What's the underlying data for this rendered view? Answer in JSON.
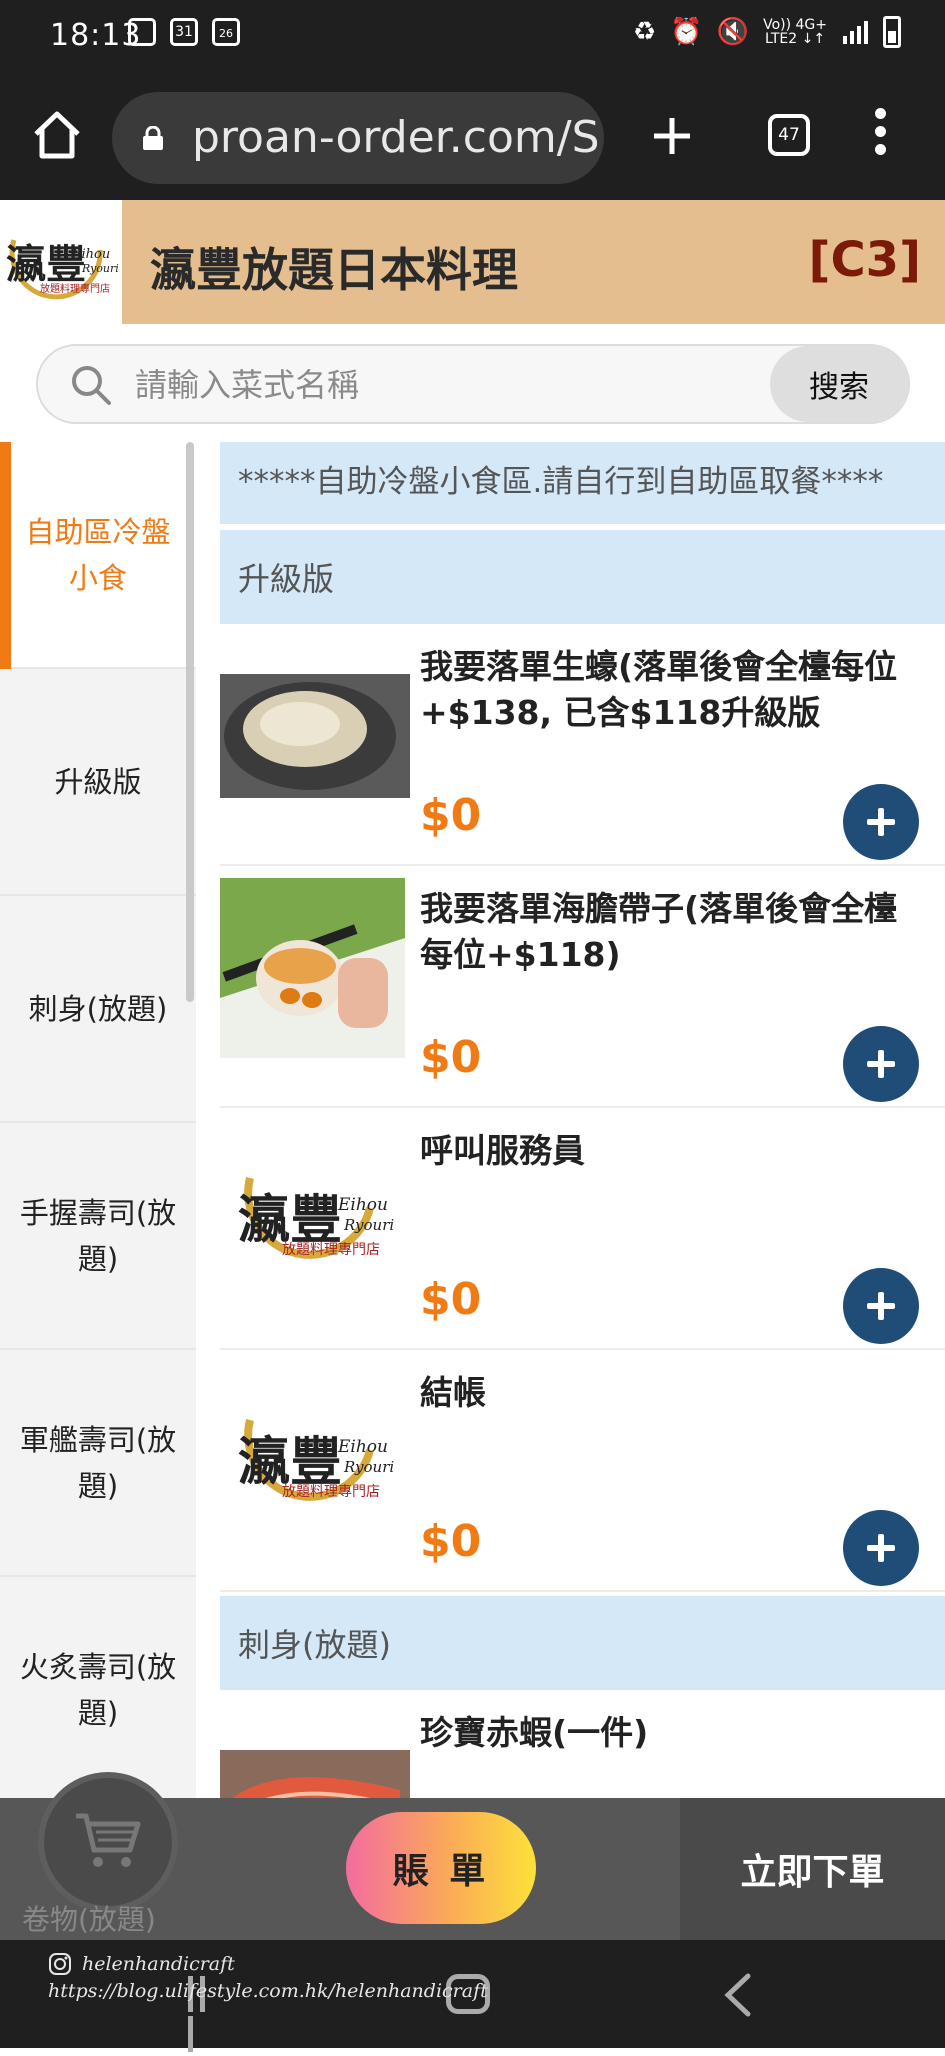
{
  "status_bar": {
    "time": "18:13",
    "calendar_badge": "31",
    "date_badge": "26",
    "network_top": "Vo)) 4G+",
    "network_bottom": "LTE2 ↓↑"
  },
  "browser": {
    "url": "proan-order.com/S",
    "tab_count": "47"
  },
  "header": {
    "title": "瀛豐放題日本料理",
    "table_code": "[C3]",
    "logo": {
      "main": "瀛豐",
      "sub_en_1": "Eihou",
      "sub_en_2": "Ryouri",
      "tagline": "放題料理專門店"
    }
  },
  "search": {
    "placeholder": "請輸入菜式名稱",
    "button": "搜索"
  },
  "sidebar": {
    "items": [
      {
        "label": "自助區冷盤小食"
      },
      {
        "label": "升級版"
      },
      {
        "label": "刺身(放題)"
      },
      {
        "label": "手握壽司(放題)"
      },
      {
        "label": "軍艦壽司(放題)"
      },
      {
        "label": "火炙壽司(放題)"
      }
    ],
    "peek_label": "卷物(放題)"
  },
  "main": {
    "notice": "*****自助冷盤小食區.請自行到自助區取餐****",
    "section_upgrade": "升級版",
    "section_sashimi": "刺身(放題)",
    "items": [
      {
        "name": "我要落單生蠔(落單後會全檯每位+$138, 已含$118升級版",
        "price": "$0"
      },
      {
        "name": "我要落單海膽帶子(落單後會全檯每位+$118)",
        "price": "$0"
      },
      {
        "name": "呼叫服務員",
        "price": "$0"
      },
      {
        "name": "結帳",
        "price": "$0"
      },
      {
        "name": "珍寶赤蝦(一件)",
        "price": ""
      }
    ]
  },
  "bottom_bar": {
    "bill_button": "賬 單",
    "order_button": "立即下單"
  },
  "watermark": {
    "handle": "helenhandicraft",
    "url": "https://blog.ulifestyle.com.hk/helenhandicraft"
  },
  "colors": {
    "header_bg": "#e4be8e",
    "accent_orange": "#f07a14",
    "add_button": "#1f4d78",
    "section_bg": "#d4e8f8"
  }
}
